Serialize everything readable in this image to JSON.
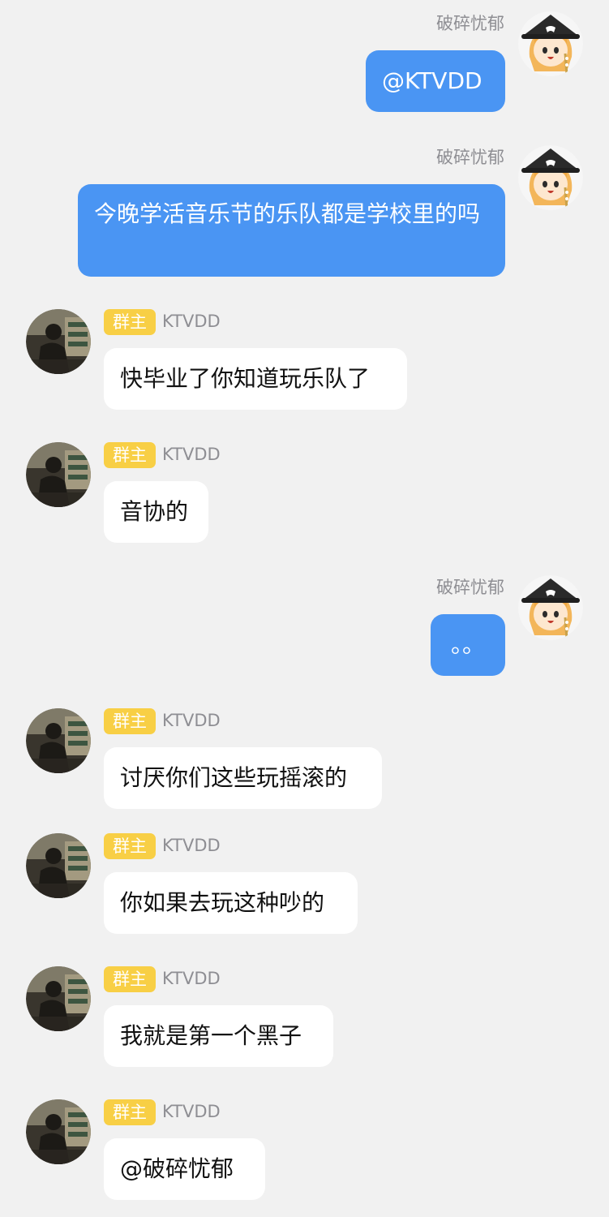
{
  "colors": {
    "background": "#f1f1f1",
    "outgoing_bubble": "#4a95f3",
    "incoming_bubble": "#ffffff",
    "owner_badge": "#f8cf45",
    "sender_name": "#8e8e93"
  },
  "messages": [
    {
      "side": "right",
      "sender": "破碎忧郁",
      "text": "@KTVDD",
      "avatar": "anime-girl-avatar"
    },
    {
      "side": "right",
      "sender": "破碎忧郁",
      "text": "今晚学活音乐节的乐队都是学校里的吗",
      "avatar": "anime-girl-avatar"
    },
    {
      "side": "left",
      "badge": "群主",
      "sender": "KTVDD",
      "text": "快毕业了你知道玩乐队了",
      "avatar": "photo-avatar"
    },
    {
      "side": "left",
      "badge": "群主",
      "sender": "KTVDD",
      "text": "音协的",
      "avatar": "photo-avatar"
    },
    {
      "side": "right",
      "sender": "破碎忧郁",
      "text": "。。",
      "avatar": "anime-girl-avatar"
    },
    {
      "side": "left",
      "badge": "群主",
      "sender": "KTVDD",
      "text": "讨厌你们这些玩摇滚的",
      "avatar": "photo-avatar"
    },
    {
      "side": "left",
      "badge": "群主",
      "sender": "KTVDD",
      "text": "你如果去玩这种吵的",
      "avatar": "photo-avatar"
    },
    {
      "side": "left",
      "badge": "群主",
      "sender": "KTVDD",
      "text": "我就是第一个黑子",
      "avatar": "photo-avatar"
    },
    {
      "side": "left",
      "badge": "群主",
      "sender": "KTVDD",
      "text": "@破碎忧郁",
      "avatar": "photo-avatar"
    }
  ]
}
